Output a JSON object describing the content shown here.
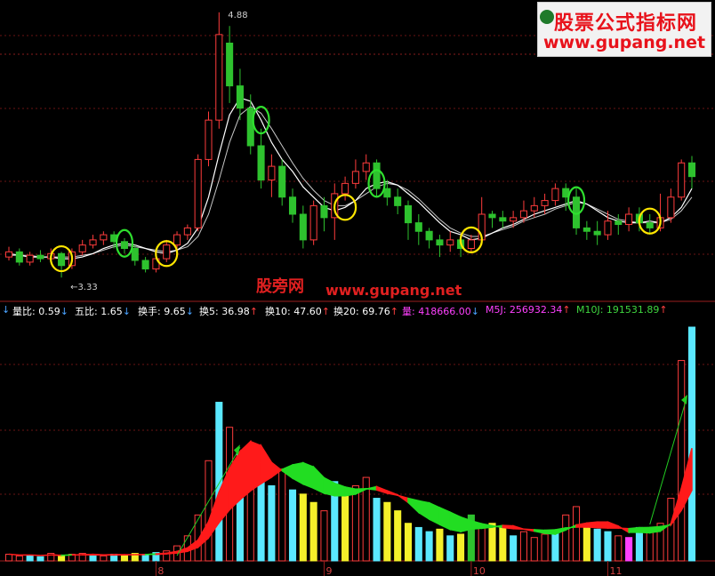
{
  "watermark": {
    "line1": "股票公式指标网",
    "line2": "www.gupang.net"
  },
  "site_label": {
    "cn": "股旁网",
    "url": "www.gupang.net"
  },
  "indicators": [
    {
      "label": "量比:",
      "value": "0.59",
      "arrow": "↓",
      "color": "#ffffff"
    },
    {
      "label": "五比:",
      "value": "1.65",
      "arrow": "↓",
      "color": "#ffffff"
    },
    {
      "label": "换手:",
      "value": "9.65",
      "arrow": "↓",
      "color": "#ffffff"
    },
    {
      "label": "换5:",
      "value": "36.98",
      "arrow": "↑",
      "color": "#ffffff"
    },
    {
      "label": "换10:",
      "value": "47.60",
      "arrow": "↑",
      "color": "#ffffff"
    },
    {
      "label": "换20:",
      "value": "69.76",
      "arrow": "↑",
      "color": "#ffffff"
    },
    {
      "label": "量:",
      "value": "418666.00",
      "arrow": "↓",
      "color": "#ff40ff"
    },
    {
      "label": "M5J:",
      "value": "256932.34",
      "arrow": "↑",
      "color": "#ff40ff"
    },
    {
      "label": "M10J:",
      "value": "191531.89",
      "arrow": "↑",
      "color": "#3fd63f"
    }
  ],
  "chart_data": {
    "type": "candlestick",
    "price_high_label": "4.88",
    "price_low_label": "←3.33",
    "x_tick_labels": [
      "8",
      "9",
      "10",
      "11"
    ],
    "x_tick_index": [
      14,
      30,
      44,
      57
    ],
    "candles": [
      [
        3.45,
        3.48,
        3.43,
        3.51
      ],
      [
        3.48,
        3.42,
        3.4,
        3.5
      ],
      [
        3.42,
        3.46,
        3.4,
        3.48
      ],
      [
        3.46,
        3.44,
        3.42,
        3.49
      ],
      [
        3.44,
        3.47,
        3.42,
        3.5
      ],
      [
        3.47,
        3.4,
        3.33,
        3.48
      ],
      [
        3.4,
        3.48,
        3.38,
        3.5
      ],
      [
        3.48,
        3.52,
        3.46,
        3.55
      ],
      [
        3.52,
        3.55,
        3.5,
        3.58
      ],
      [
        3.55,
        3.58,
        3.52,
        3.6
      ],
      [
        3.58,
        3.54,
        3.5,
        3.6
      ],
      [
        3.54,
        3.5,
        3.47,
        3.56
      ],
      [
        3.5,
        3.43,
        3.4,
        3.52
      ],
      [
        3.43,
        3.38,
        3.36,
        3.45
      ],
      [
        3.38,
        3.44,
        3.36,
        3.47
      ],
      [
        3.44,
        3.52,
        3.42,
        3.55
      ],
      [
        3.52,
        3.58,
        3.5,
        3.6
      ],
      [
        3.58,
        3.62,
        3.55,
        3.64
      ],
      [
        3.62,
        4.02,
        3.6,
        4.05
      ],
      [
        4.02,
        4.25,
        3.98,
        4.3
      ],
      [
        4.25,
        4.75,
        4.2,
        4.88
      ],
      [
        4.7,
        4.45,
        4.35,
        4.8
      ],
      [
        4.45,
        4.32,
        4.25,
        4.55
      ],
      [
        4.32,
        4.1,
        4.05,
        4.4
      ],
      [
        4.1,
        3.9,
        3.85,
        4.2
      ],
      [
        3.9,
        3.98,
        3.8,
        4.05
      ],
      [
        3.98,
        3.8,
        3.75,
        4.02
      ],
      [
        3.8,
        3.7,
        3.65,
        3.85
      ],
      [
        3.7,
        3.55,
        3.5,
        3.75
      ],
      [
        3.55,
        3.75,
        3.52,
        3.78
      ],
      [
        3.75,
        3.68,
        3.6,
        3.8
      ],
      [
        3.68,
        3.82,
        3.55,
        3.88
      ],
      [
        3.82,
        3.88,
        3.78,
        3.92
      ],
      [
        3.88,
        3.95,
        3.85,
        4.02
      ],
      [
        3.95,
        4.0,
        3.9,
        4.05
      ],
      [
        4.0,
        3.85,
        3.8,
        4.02
      ],
      [
        3.85,
        3.8,
        3.75,
        3.9
      ],
      [
        3.8,
        3.75,
        3.7,
        3.85
      ],
      [
        3.75,
        3.65,
        3.55,
        3.78
      ],
      [
        3.65,
        3.6,
        3.52,
        3.7
      ],
      [
        3.6,
        3.55,
        3.5,
        3.62
      ],
      [
        3.55,
        3.52,
        3.45,
        3.58
      ],
      [
        3.52,
        3.55,
        3.48,
        3.6
      ],
      [
        3.55,
        3.5,
        3.45,
        3.58
      ],
      [
        3.5,
        3.55,
        3.48,
        3.58
      ],
      [
        3.55,
        3.7,
        3.52,
        3.8
      ],
      [
        3.7,
        3.68,
        3.62,
        3.72
      ],
      [
        3.68,
        3.66,
        3.62,
        3.72
      ],
      [
        3.66,
        3.68,
        3.62,
        3.72
      ],
      [
        3.68,
        3.72,
        3.65,
        3.78
      ],
      [
        3.72,
        3.75,
        3.68,
        3.8
      ],
      [
        3.75,
        3.78,
        3.7,
        3.82
      ],
      [
        3.78,
        3.85,
        3.75,
        3.88
      ],
      [
        3.85,
        3.8,
        3.72,
        3.88
      ],
      [
        3.8,
        3.62,
        3.58,
        3.85
      ],
      [
        3.62,
        3.6,
        3.55,
        3.66
      ],
      [
        3.6,
        3.58,
        3.52,
        3.66
      ],
      [
        3.58,
        3.66,
        3.55,
        3.72
      ],
      [
        3.66,
        3.64,
        3.58,
        3.7
      ],
      [
        3.64,
        3.7,
        3.6,
        3.74
      ],
      [
        3.7,
        3.65,
        3.6,
        3.74
      ],
      [
        3.65,
        3.62,
        3.58,
        3.7
      ],
      [
        3.62,
        3.68,
        3.6,
        3.82
      ],
      [
        3.68,
        3.8,
        3.65,
        3.85
      ],
      [
        3.8,
        4.0,
        3.78,
        4.02
      ],
      [
        4.0,
        3.92,
        3.85,
        4.04
      ]
    ],
    "ma_white": [
      3.47,
      3.46,
      3.45,
      3.45,
      3.45,
      3.44,
      3.44,
      3.45,
      3.47,
      3.5,
      3.52,
      3.53,
      3.52,
      3.5,
      3.48,
      3.47,
      3.49,
      3.53,
      3.62,
      3.8,
      4.05,
      4.28,
      4.38,
      4.36,
      4.25,
      4.12,
      4.02,
      3.95,
      3.86,
      3.8,
      3.74,
      3.72,
      3.74,
      3.78,
      3.85,
      3.88,
      3.89,
      3.87,
      3.82,
      3.77,
      3.71,
      3.65,
      3.6,
      3.58,
      3.55,
      3.56,
      3.59,
      3.62,
      3.64,
      3.67,
      3.7,
      3.72,
      3.74,
      3.76,
      3.78,
      3.76,
      3.72,
      3.68,
      3.66,
      3.65,
      3.65,
      3.66,
      3.65,
      3.68,
      3.74,
      3.85
    ],
    "ma_gray": [
      3.46,
      3.46,
      3.46,
      3.45,
      3.45,
      3.45,
      3.45,
      3.46,
      3.47,
      3.49,
      3.51,
      3.52,
      3.51,
      3.5,
      3.49,
      3.48,
      3.49,
      3.51,
      3.57,
      3.7,
      3.9,
      4.12,
      4.28,
      4.33,
      4.29,
      4.2,
      4.1,
      4.0,
      3.91,
      3.84,
      3.78,
      3.75,
      3.75,
      3.78,
      3.82,
      3.86,
      3.88,
      3.87,
      3.84,
      3.79,
      3.73,
      3.67,
      3.62,
      3.59,
      3.57,
      3.57,
      3.59,
      3.61,
      3.63,
      3.66,
      3.68,
      3.7,
      3.73,
      3.75,
      3.77,
      3.76,
      3.73,
      3.7,
      3.67,
      3.66,
      3.65,
      3.65,
      3.65,
      3.67,
      3.72,
      3.8
    ],
    "volume": [
      8,
      6,
      7,
      5,
      9,
      6,
      8,
      9,
      7,
      6,
      8,
      7,
      9,
      8,
      10,
      12,
      18,
      30,
      55,
      120,
      190,
      160,
      130,
      115,
      95,
      90,
      110,
      85,
      80,
      70,
      60,
      95,
      85,
      90,
      100,
      75,
      70,
      60,
      45,
      40,
      35,
      38,
      30,
      32,
      55,
      40,
      45,
      40,
      30,
      35,
      28,
      32,
      35,
      55,
      65,
      40,
      38,
      35,
      30,
      28,
      40,
      35,
      45,
      75,
      240,
      280
    ],
    "volume_colors": [
      "r",
      "r",
      "c",
      "c",
      "r",
      "y",
      "r",
      "r",
      "c",
      "r",
      "c",
      "y",
      "y",
      "c",
      "c",
      "r",
      "r",
      "r",
      "r",
      "r",
      "c",
      "r",
      "c",
      "r",
      "c",
      "c",
      "r",
      "c",
      "y",
      "y",
      "r",
      "c",
      "y",
      "r",
      "r",
      "c",
      "y",
      "y",
      "y",
      "c",
      "c",
      "y",
      "c",
      "y",
      "g",
      "r",
      "y",
      "y",
      "c",
      "r",
      "r",
      "r",
      "c",
      "r",
      "r",
      "y",
      "c",
      "c",
      "r",
      "m",
      "c",
      "r",
      "r",
      "r",
      "r",
      "c"
    ],
    "circles": [
      {
        "i": 5,
        "color": "yellow"
      },
      {
        "i": 11,
        "color": "green"
      },
      {
        "i": 15,
        "color": "yellow"
      },
      {
        "i": 24,
        "color": "green"
      },
      {
        "i": 32,
        "color": "yellow"
      },
      {
        "i": 35,
        "color": "green"
      },
      {
        "i": 44,
        "color": "yellow"
      },
      {
        "i": 54,
        "color": "green"
      },
      {
        "i": 61,
        "color": "yellow"
      }
    ]
  }
}
